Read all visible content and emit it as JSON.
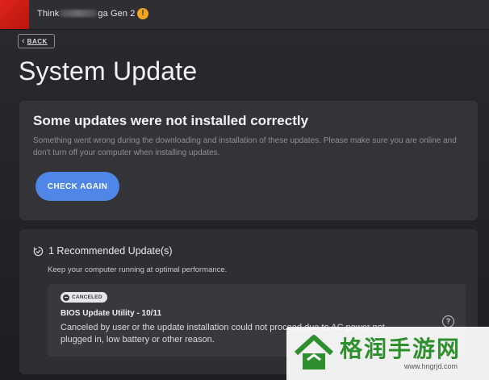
{
  "titlebar": {
    "title_prefix": "Think",
    "title_suffix": "ga Gen 2",
    "warning_glyph": "!"
  },
  "nav": {
    "back_label": "BACK"
  },
  "page": {
    "title": "System Update"
  },
  "error_card": {
    "title": "Some updates were not installed correctly",
    "description": "Something went wrong during the downloading and installation of these updates. Please make sure you are online and don't turn off your computer when installing updates.",
    "button_label": "CHECK AGAIN"
  },
  "recommended": {
    "title": "1 Recommended Update(s)",
    "description": "Keep your computer running at optimal performance.",
    "items": [
      {
        "status": "CANCELED",
        "name": "BIOS Update Utility - 10/11",
        "message": "Canceled by user or the update installation could not proceed due to AC power not plugged in, low battery or other reason."
      }
    ]
  },
  "watermark": {
    "text": "格润手游网",
    "url": "www.hngrjd.com"
  },
  "colors": {
    "accent_red": "#e0231c",
    "button_blue": "#4f86e8",
    "warning_orange": "#f0a51c",
    "watermark_green": "#2e8f2e"
  },
  "icons": {
    "warning": "warning-icon",
    "back": "chevron-left-icon",
    "recommended": "refresh-check-icon",
    "status": "minus-circle-icon",
    "help": "question-icon"
  }
}
